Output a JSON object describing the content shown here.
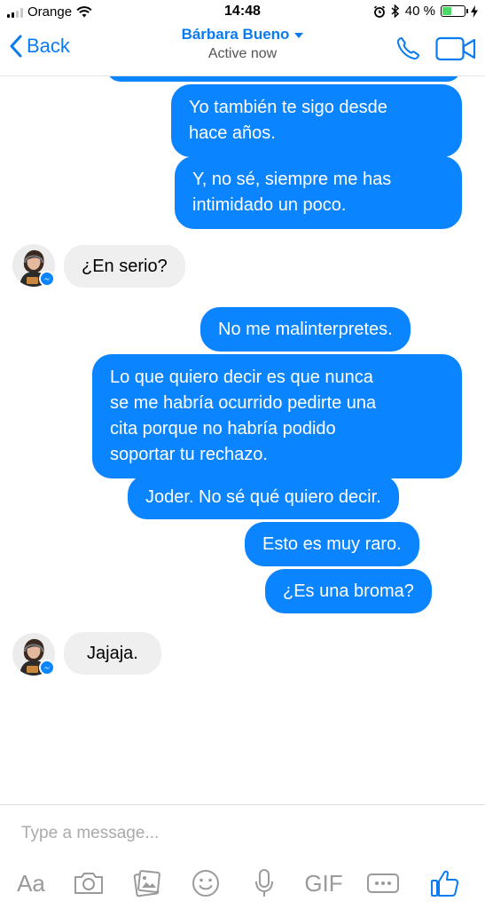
{
  "status_bar": {
    "carrier": "Orange",
    "time": "14:48",
    "battery": "40 %",
    "battery_level": 0.4
  },
  "header": {
    "back_label": "Back",
    "contact_name": "Bárbara Bueno",
    "status": "Active now"
  },
  "messages": [
    {
      "from": "me",
      "text": "Yo también te sigo desde\nhace años."
    },
    {
      "from": "me",
      "text": "Y, no sé, siempre me has\nintimidado un poco."
    },
    {
      "from": "them",
      "text": "¿En serio?"
    },
    {
      "from": "me",
      "text": "No me malinterpretes."
    },
    {
      "from": "me",
      "text": "Lo que quiero decir es que nunca\nse me habría ocurrido pedirte una\ncita porque no habría podido\nsoportar tu rechazo."
    },
    {
      "from": "me",
      "text": "Joder. No sé qué quiero decir."
    },
    {
      "from": "me",
      "text": "Esto es muy raro."
    },
    {
      "from": "me",
      "text": "¿Es una broma?"
    },
    {
      "from": "them",
      "text": "Jajaja."
    }
  ],
  "composer": {
    "placeholder": "Type a message...",
    "text_tool_label": "Aa",
    "gif_label": "GIF"
  },
  "icons": {
    "back": "chevron-left-icon",
    "call": "phone-icon",
    "video": "video-camera-icon",
    "camera": "camera-icon",
    "gallery": "photo-gallery-icon",
    "emoji": "smiley-icon",
    "mic": "microphone-icon",
    "more": "more-icon",
    "like": "thumbs-up-icon"
  },
  "colors": {
    "accent": "#0b7bf0",
    "outgoing_bubble": "#0b84ff",
    "incoming_bubble": "#efefef"
  }
}
